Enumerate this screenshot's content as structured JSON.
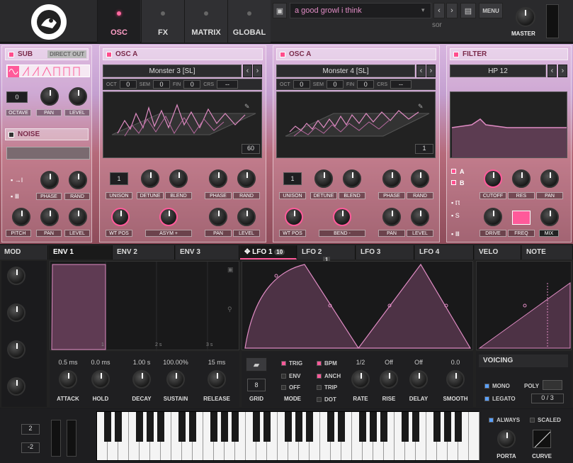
{
  "top": {
    "tabs": [
      {
        "label": "OSC",
        "active": true
      },
      {
        "label": "FX"
      },
      {
        "label": "MATRIX"
      },
      {
        "label": "GLOBAL"
      }
    ],
    "preset_name": "a good growl i think",
    "author": "sor",
    "menu_label": "MENU",
    "master_label": "MASTER"
  },
  "sub": {
    "title": "SUB",
    "direct_out": "DIRECT OUT",
    "octave_value": "0",
    "octave_label": "OCTAVE",
    "pan_label": "PAN",
    "level_label": "LEVEL"
  },
  "noise": {
    "title": "NOISE",
    "phase_label": "PHASE",
    "rand_label": "RAND",
    "pitch_label": "PITCH",
    "pan_label": "PAN",
    "level_label": "LEVEL"
  },
  "osc_a": {
    "title": "OSC A",
    "wavetable": "Monster 3 [SL]",
    "oct_label": "OCT",
    "oct": "0",
    "sem_label": "SEM",
    "sem": "0",
    "fin_label": "FIN",
    "fin": "0",
    "crs_label": "CRS",
    "crs": "--",
    "frame": "60",
    "unison": "1",
    "unison_label": "UNISON",
    "detune_label": "DETUNE",
    "blend_label": "BLEND",
    "phase_label": "PHASE",
    "rand_label": "RAND",
    "wtpos_label": "WT POS",
    "warp": "ASYM +",
    "pan_label": "PAN",
    "level_label": "LEVEL"
  },
  "osc_b": {
    "title": "OSC A",
    "wavetable": "Monster 4 [SL]",
    "oct_label": "OCT",
    "oct": "0",
    "sem_label": "SEM",
    "sem": "0",
    "fin_label": "FIN",
    "fin": "0",
    "crs_label": "CRS",
    "crs": "--",
    "frame": "1",
    "unison": "1",
    "unison_label": "UNISON",
    "detune_label": "DETUNE",
    "blend_label": "BLEND",
    "phase_label": "PHASE",
    "rand_label": "RAND",
    "wtpos_label": "WT POS",
    "warp": "BEND -",
    "pan_label": "PAN",
    "level_label": "LEVEL"
  },
  "filter": {
    "title": "FILTER",
    "type": "HP 12",
    "a": "A",
    "b": "B",
    "cutoff_label": "CUTOFF",
    "res_label": "RES",
    "pan_label": "PAN",
    "drive_label": "DRIVE",
    "freq_label": "FREQ",
    "mix_label": "MIX"
  },
  "mod": {
    "title": "MOD",
    "tabs": [
      "ENV 1",
      "ENV 2",
      "ENV 3"
    ],
    "lfo_tabs": [
      "LFO 1",
      "LFO 2",
      "LFO 3",
      "LFO 4"
    ],
    "lfo1_badge": "10",
    "lfo2_badge": "1",
    "velo": "VELO",
    "note": "NOTE",
    "time_marks": [
      "1",
      "2 s",
      "3 s"
    ]
  },
  "env": {
    "attack": "0.5 ms",
    "hold": "0.0 ms",
    "decay": "1.00 s",
    "sustain": "100.00%",
    "release": "15 ms",
    "attack_label": "ATTACK",
    "hold_label": "HOLD",
    "decay_label": "DECAY",
    "sustain_label": "SUSTAIN",
    "release_label": "RELEASE"
  },
  "lfo": {
    "grid": "8",
    "grid_label": "GRID",
    "trig": "TRIG",
    "env": "ENV",
    "off": "OFF",
    "mode_label": "MODE",
    "bpm": "BPM",
    "anch": "ANCH",
    "trip": "TRIP",
    "dot": "DOT",
    "rate": "1/2",
    "rise": "Off",
    "delay": "Off",
    "smooth": "0.0",
    "rate_label": "RATE",
    "rise_label": "RISE",
    "delay_label": "DELAY",
    "smooth_label": "SMOOTH"
  },
  "voicing": {
    "title": "VOICING",
    "mono": "MONO",
    "poly": "POLY",
    "legato": "LEGATO",
    "voices": "0 / 3"
  },
  "keys": {
    "oct_up": "2",
    "oct_down": "-2",
    "always": "ALWAYS",
    "scaled": "SCALED",
    "porta": "PORTA",
    "curve": "CURVE"
  },
  "colors": {
    "accent": "#ff5a9a",
    "panel": "#c28aa0"
  }
}
